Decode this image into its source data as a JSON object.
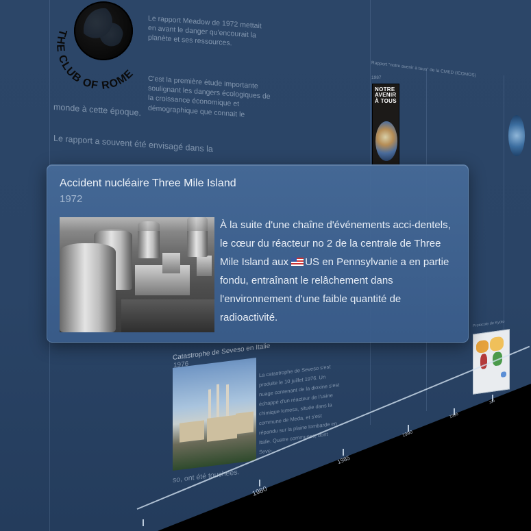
{
  "background": {
    "club_of_rome": {
      "logo_text": "THE CLUB OF ROME",
      "paragraph1": "Le rapport Meadow de 1972 mettait en avant le danger qu'encourait la planète et ses ressources.",
      "paragraph2": "C'est la première étude importante soulignant les dangers écologiques de la croissance économique et démographique que connait le",
      "paragraph2_end": "monde à cette époque.",
      "paragraph3": "Le rapport a souvent été envisagé dans la"
    },
    "cmed_report": {
      "title": "Rapport \"notre avenir à tous\" de la CMED (ICOMOS)",
      "year": "1987",
      "book_text": "NOTRE AVENIR À TOUS"
    },
    "seveso": {
      "title": "Catastrophe de Seveso en Italie",
      "year": "1976",
      "text": "La catastrophe de Seveso s'est produite le 10 juillet 1976. Un nuage contenant de la dioxine s'est échappé d'un réacteur de l'usine chimique Icmesa, située dans la commune de Meda, et s'est répandu sur la plaine lombarde en Italie. Quatre communes, dont Seve-",
      "text_end": "so, ont été touchées."
    },
    "protocol": {
      "title": "Protocole de Kyoto"
    }
  },
  "timeline": {
    "ticks": [
      "1980",
      "1985",
      "1990",
      "1995",
      "200"
    ]
  },
  "popup": {
    "title": "Accident nucléaire Three Mile Island",
    "year": "1972",
    "text_before_flag": "À la suite d'une chaîne d'événements acci-dentels, le cœur du réacteur no 2 de la centrale de Three Mile Island aux ",
    "text_after_flag": "US en Pennsylvanie a en partie fondu, entraînant le relâchement dans l'environnement d'une faible quantité de radioactivité."
  },
  "colors": {
    "background": "#2c4668",
    "popup": "#466a98",
    "text": "#e8eef6"
  }
}
